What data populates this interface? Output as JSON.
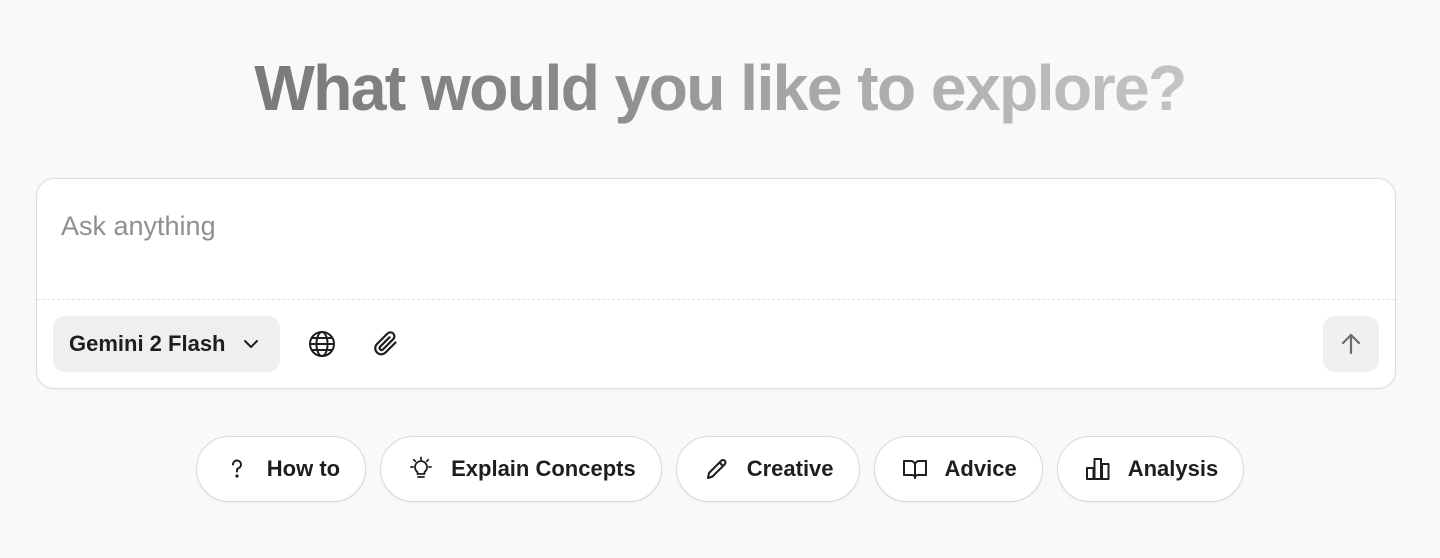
{
  "hero": {
    "title": "What would you like to explore?"
  },
  "composer": {
    "placeholder": "Ask anything",
    "value": "",
    "model": {
      "selected": "Gemini 2 Flash",
      "icon": "chevron-down-icon"
    },
    "tools": [
      {
        "name": "web-search",
        "icon": "globe-icon"
      },
      {
        "name": "attach",
        "icon": "paperclip-icon"
      }
    ],
    "send_icon": "arrow-up-icon"
  },
  "suggestions": [
    {
      "label": "How to",
      "icon": "question-icon"
    },
    {
      "label": "Explain Concepts",
      "icon": "lightbulb-icon"
    },
    {
      "label": "Creative",
      "icon": "pencil-icon"
    },
    {
      "label": "Advice",
      "icon": "book-icon"
    },
    {
      "label": "Analysis",
      "icon": "bar-chart-icon"
    }
  ],
  "colors": {
    "background": "#f9f9f9",
    "surface": "#ffffff",
    "border": "#dcdcdc",
    "chip_fill": "#efefef",
    "text": "#1e1e1e",
    "placeholder": "#8f8f8f"
  }
}
